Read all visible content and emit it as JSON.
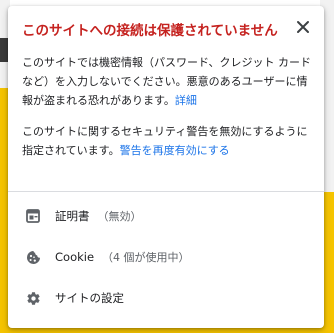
{
  "popup": {
    "title": "このサイトへの接続は保護されていません",
    "warning_text": "このサイトでは機密情報（パスワード、クレジット カードなど）を入力しないでください。悪意のあるユーザーに情報が盗まれる恐れがあります。",
    "details_link": "詳細",
    "policy_text": "このサイトに関するセキュリティ警告を無効にするように指定されています。",
    "reenable_link": "警告を再度有効にする",
    "items": [
      {
        "icon": "certificate-icon",
        "label": "証明書",
        "sub": "（無効）"
      },
      {
        "icon": "cookie-icon",
        "label": "Cookie",
        "sub": "（4 個が使用中）"
      },
      {
        "icon": "gear-icon",
        "label": "サイトの設定",
        "sub": ""
      }
    ]
  },
  "colors": {
    "title": "#c5221f",
    "link": "#1a73e8",
    "text": "#202124",
    "secondary_text": "#5f6368",
    "icon": "#5f6368",
    "background_accent": "#f5c400"
  }
}
